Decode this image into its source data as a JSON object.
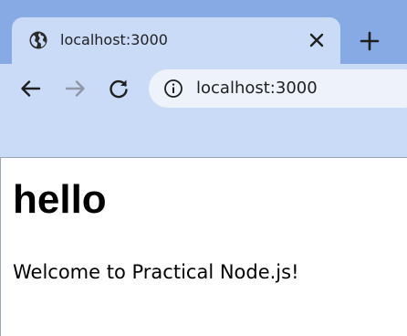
{
  "browser": {
    "tab": {
      "title": "localhost:3000",
      "favicon": "globe-icon",
      "close_icon": "close-icon"
    },
    "new_tab_icon": "plus-icon",
    "toolbar": {
      "back_icon": "arrow-left-icon",
      "forward_icon": "arrow-right-icon",
      "reload_icon": "reload-icon",
      "site_info_icon": "info-icon",
      "url": "localhost:3000"
    },
    "colors": {
      "tabstrip_bg": "#87a9e4",
      "toolbar_bg": "#c9dbf6",
      "omnibox_bg": "#eef3fb"
    }
  },
  "page": {
    "heading": "hello",
    "text": "Welcome to Practical Node.js!"
  }
}
